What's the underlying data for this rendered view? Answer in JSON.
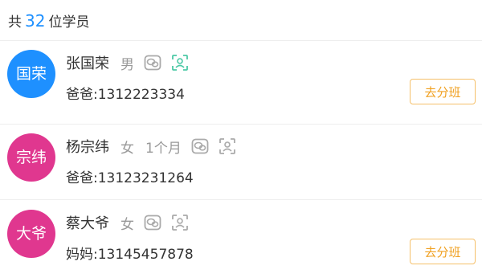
{
  "header": {
    "prefix": "共",
    "count": "32",
    "suffix": "位学员"
  },
  "students": [
    {
      "avatar_text": "国荣",
      "avatar_color": "#1e90ff",
      "name": "张国荣",
      "gender": "男",
      "age": "",
      "wechat_icon": "wechat-icon",
      "face_icon": "face-scan-icon",
      "face_icon_color": "#4cc9a6",
      "phone": "爸爸:1312223334",
      "button_label": "去分班",
      "has_button": true
    },
    {
      "avatar_text": "宗纬",
      "avatar_color": "#e0378f",
      "name": "杨宗纬",
      "gender": "女",
      "age": "1个月",
      "wechat_icon": "wechat-icon",
      "face_icon": "face-scan-icon",
      "face_icon_color": "#aaaaaa",
      "phone": "爸爸:13123231264",
      "button_label": "",
      "has_button": false
    },
    {
      "avatar_text": "大爷",
      "avatar_color": "#e0378f",
      "name": "蔡大爷",
      "gender": "女",
      "age": "",
      "wechat_icon": "wechat-icon",
      "face_icon": "face-scan-icon",
      "face_icon_color": "#aaaaaa",
      "phone": "妈妈:13145457878",
      "button_label": "去分班",
      "has_button": true
    }
  ]
}
